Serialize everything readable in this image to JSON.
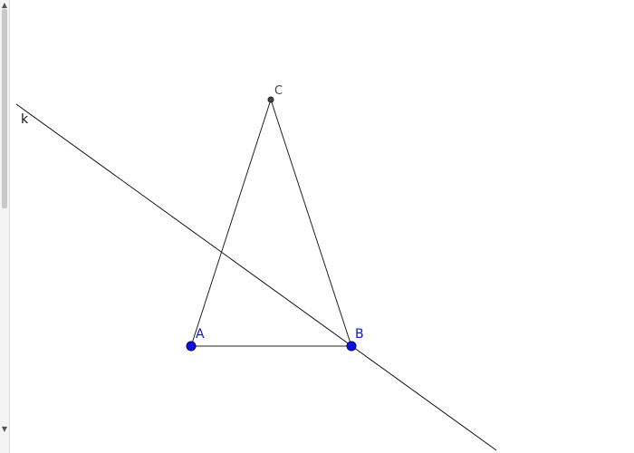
{
  "construction": {
    "point_a": {
      "label": "A",
      "color": "#1111dd"
    },
    "point_b": {
      "label": "B",
      "color": "#1111dd"
    },
    "point_c": {
      "label": "C",
      "color": "#444444"
    },
    "line_k": {
      "label": "k",
      "color": "#111111"
    },
    "triangle": {
      "stroke_color": "#222222"
    }
  },
  "scrollbar": {
    "up_arrow": "▲",
    "down_arrow": "▼"
  }
}
